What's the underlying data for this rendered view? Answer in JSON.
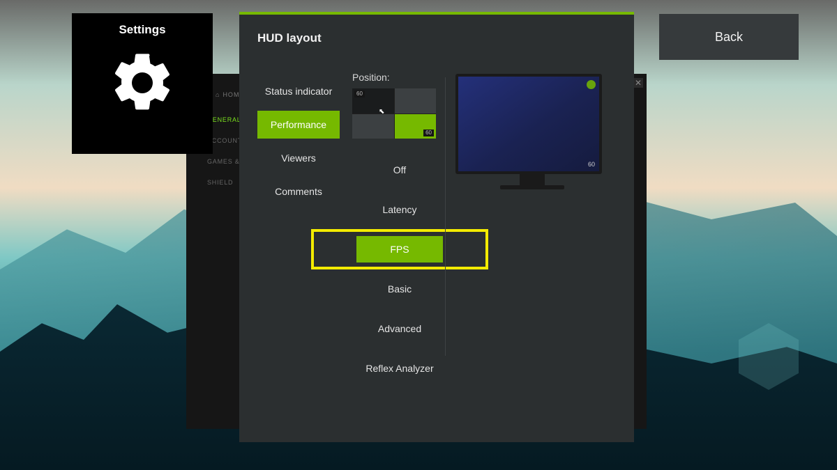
{
  "colors": {
    "accent": "#76b900",
    "highlight": "#f3eb00"
  },
  "settings_badge": {
    "title": "Settings"
  },
  "behind_panel": {
    "home": "HOME",
    "items": [
      {
        "label": "GENERAL",
        "active": true
      },
      {
        "label": "ACCOUNT",
        "active": false
      },
      {
        "label": "GAMES & APPS",
        "active": false
      },
      {
        "label": "SHIELD",
        "active": false
      }
    ]
  },
  "main": {
    "title": "HUD layout",
    "tabs": [
      {
        "label": "Status indicator",
        "selected": false
      },
      {
        "label": "Performance",
        "selected": true
      },
      {
        "label": "Viewers",
        "selected": false
      },
      {
        "label": "Comments",
        "selected": false
      }
    ],
    "position": {
      "label": "Position:",
      "overlay_number": "60",
      "options": [
        {
          "label": "Off",
          "highlighted": false
        },
        {
          "label": "Latency",
          "highlighted": false
        },
        {
          "label": "FPS",
          "highlighted": true
        },
        {
          "label": "Basic",
          "highlighted": false
        },
        {
          "label": "Advanced",
          "highlighted": false
        },
        {
          "label": "Reflex Analyzer",
          "highlighted": false
        }
      ]
    },
    "preview": {
      "fps_value": "60"
    }
  },
  "back_button": {
    "label": "Back"
  }
}
